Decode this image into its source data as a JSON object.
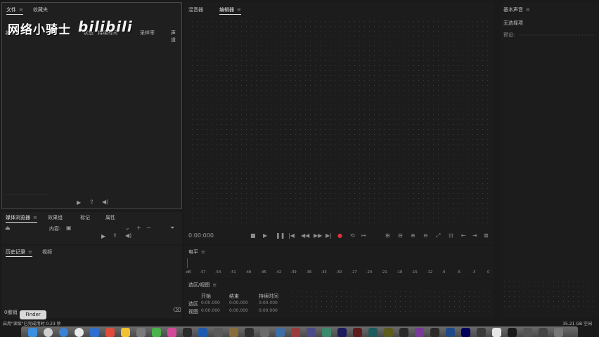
{
  "project": {
    "tabs": [
      "文件",
      "收藏夹"
    ],
    "columns": [
      "名称",
      "状态",
      "持续时间",
      "采样率",
      "声道"
    ],
    "watermark_text": "网络小骑士",
    "watermark_logo": "bilibili"
  },
  "monitor": {
    "tabs": [
      "混音器",
      "编辑器"
    ],
    "timecode": "0:00:000"
  },
  "essential": {
    "title": "基本声音",
    "subtitle": "无选择项",
    "preset_label": "预设:"
  },
  "media": {
    "tabs": [
      "媒体浏览器",
      "效果组",
      "标记",
      "属性"
    ],
    "content_label": "内容:"
  },
  "history": {
    "tabs": [
      "历史记录",
      "视频"
    ],
    "undo_label": "0撤销"
  },
  "level": {
    "title": "电平",
    "ticks": [
      "-dB",
      "-57",
      "-54",
      "-51",
      "-48",
      "-45",
      "-42",
      "-39",
      "-36",
      "-33",
      "-30",
      "-27",
      "-24",
      "-21",
      "-18",
      "-15",
      "-12",
      "-9",
      "-6",
      "-3",
      "0"
    ]
  },
  "selection": {
    "title": "选区/视图",
    "headers": [
      "开始",
      "结束",
      "持续时间"
    ],
    "rows": [
      {
        "label": "选区",
        "start": "0:00.000",
        "end": "0:00.000",
        "duration": "0:00.000"
      },
      {
        "label": "视图",
        "start": "0:00.000",
        "end": "0:00.000",
        "duration": "0:00.000"
      }
    ]
  },
  "status": {
    "left": "启用\"读取\"已完成用时 0.23 秒",
    "right": "35.21 GB 空闲",
    "finder_tooltip": "Finder"
  },
  "colors": {
    "record": "#e0303a",
    "panel_border": "#4a4a4a"
  }
}
